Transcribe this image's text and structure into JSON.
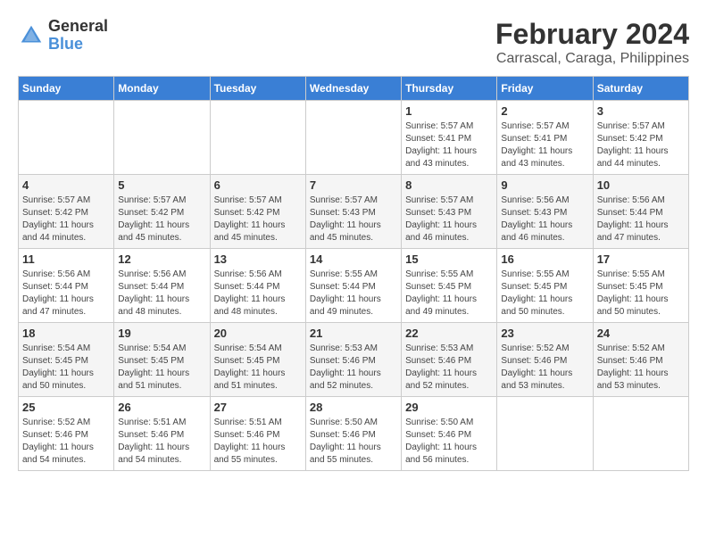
{
  "header": {
    "logo_line1": "General",
    "logo_line2": "Blue",
    "title": "February 2024",
    "subtitle": "Carrascal, Caraga, Philippines"
  },
  "weekdays": [
    "Sunday",
    "Monday",
    "Tuesday",
    "Wednesday",
    "Thursday",
    "Friday",
    "Saturday"
  ],
  "weeks": [
    [
      {
        "day": "",
        "info": ""
      },
      {
        "day": "",
        "info": ""
      },
      {
        "day": "",
        "info": ""
      },
      {
        "day": "",
        "info": ""
      },
      {
        "day": "1",
        "info": "Sunrise: 5:57 AM\nSunset: 5:41 PM\nDaylight: 11 hours and 43 minutes."
      },
      {
        "day": "2",
        "info": "Sunrise: 5:57 AM\nSunset: 5:41 PM\nDaylight: 11 hours and 43 minutes."
      },
      {
        "day": "3",
        "info": "Sunrise: 5:57 AM\nSunset: 5:42 PM\nDaylight: 11 hours and 44 minutes."
      }
    ],
    [
      {
        "day": "4",
        "info": "Sunrise: 5:57 AM\nSunset: 5:42 PM\nDaylight: 11 hours and 44 minutes."
      },
      {
        "day": "5",
        "info": "Sunrise: 5:57 AM\nSunset: 5:42 PM\nDaylight: 11 hours and 45 minutes."
      },
      {
        "day": "6",
        "info": "Sunrise: 5:57 AM\nSunset: 5:42 PM\nDaylight: 11 hours and 45 minutes."
      },
      {
        "day": "7",
        "info": "Sunrise: 5:57 AM\nSunset: 5:43 PM\nDaylight: 11 hours and 45 minutes."
      },
      {
        "day": "8",
        "info": "Sunrise: 5:57 AM\nSunset: 5:43 PM\nDaylight: 11 hours and 46 minutes."
      },
      {
        "day": "9",
        "info": "Sunrise: 5:56 AM\nSunset: 5:43 PM\nDaylight: 11 hours and 46 minutes."
      },
      {
        "day": "10",
        "info": "Sunrise: 5:56 AM\nSunset: 5:44 PM\nDaylight: 11 hours and 47 minutes."
      }
    ],
    [
      {
        "day": "11",
        "info": "Sunrise: 5:56 AM\nSunset: 5:44 PM\nDaylight: 11 hours and 47 minutes."
      },
      {
        "day": "12",
        "info": "Sunrise: 5:56 AM\nSunset: 5:44 PM\nDaylight: 11 hours and 48 minutes."
      },
      {
        "day": "13",
        "info": "Sunrise: 5:56 AM\nSunset: 5:44 PM\nDaylight: 11 hours and 48 minutes."
      },
      {
        "day": "14",
        "info": "Sunrise: 5:55 AM\nSunset: 5:44 PM\nDaylight: 11 hours and 49 minutes."
      },
      {
        "day": "15",
        "info": "Sunrise: 5:55 AM\nSunset: 5:45 PM\nDaylight: 11 hours and 49 minutes."
      },
      {
        "day": "16",
        "info": "Sunrise: 5:55 AM\nSunset: 5:45 PM\nDaylight: 11 hours and 50 minutes."
      },
      {
        "day": "17",
        "info": "Sunrise: 5:55 AM\nSunset: 5:45 PM\nDaylight: 11 hours and 50 minutes."
      }
    ],
    [
      {
        "day": "18",
        "info": "Sunrise: 5:54 AM\nSunset: 5:45 PM\nDaylight: 11 hours and 50 minutes."
      },
      {
        "day": "19",
        "info": "Sunrise: 5:54 AM\nSunset: 5:45 PM\nDaylight: 11 hours and 51 minutes."
      },
      {
        "day": "20",
        "info": "Sunrise: 5:54 AM\nSunset: 5:45 PM\nDaylight: 11 hours and 51 minutes."
      },
      {
        "day": "21",
        "info": "Sunrise: 5:53 AM\nSunset: 5:46 PM\nDaylight: 11 hours and 52 minutes."
      },
      {
        "day": "22",
        "info": "Sunrise: 5:53 AM\nSunset: 5:46 PM\nDaylight: 11 hours and 52 minutes."
      },
      {
        "day": "23",
        "info": "Sunrise: 5:52 AM\nSunset: 5:46 PM\nDaylight: 11 hours and 53 minutes."
      },
      {
        "day": "24",
        "info": "Sunrise: 5:52 AM\nSunset: 5:46 PM\nDaylight: 11 hours and 53 minutes."
      }
    ],
    [
      {
        "day": "25",
        "info": "Sunrise: 5:52 AM\nSunset: 5:46 PM\nDaylight: 11 hours and 54 minutes."
      },
      {
        "day": "26",
        "info": "Sunrise: 5:51 AM\nSunset: 5:46 PM\nDaylight: 11 hours and 54 minutes."
      },
      {
        "day": "27",
        "info": "Sunrise: 5:51 AM\nSunset: 5:46 PM\nDaylight: 11 hours and 55 minutes."
      },
      {
        "day": "28",
        "info": "Sunrise: 5:50 AM\nSunset: 5:46 PM\nDaylight: 11 hours and 55 minutes."
      },
      {
        "day": "29",
        "info": "Sunrise: 5:50 AM\nSunset: 5:46 PM\nDaylight: 11 hours and 56 minutes."
      },
      {
        "day": "",
        "info": ""
      },
      {
        "day": "",
        "info": ""
      }
    ]
  ]
}
